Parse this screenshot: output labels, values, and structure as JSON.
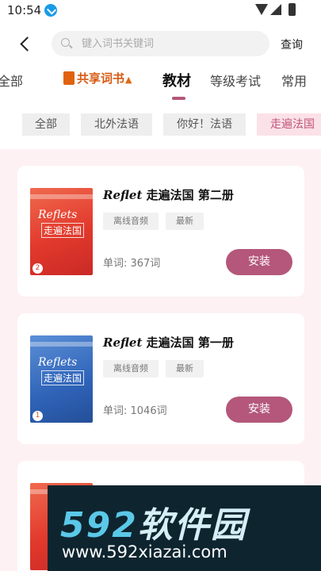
{
  "status_bar": {
    "time": "10:54",
    "icons": [
      "download-icon",
      "wifi-icon",
      "signal-icon",
      "battery-icon"
    ]
  },
  "header": {
    "back_icon": "chevron-left-icon",
    "search": {
      "placeholder": "键入词书关键词",
      "value": "",
      "icon": "search-icon"
    },
    "query_label": "查询"
  },
  "tabs": {
    "all": "全部",
    "shared": "共享词书",
    "textbook": "教材",
    "level_exam": "等级考试",
    "common": "常用",
    "active": "教材"
  },
  "filters": [
    "全部",
    "北外法语",
    "你好！法语",
    "走遍法国"
  ],
  "active_filter": "走遍法国",
  "books": [
    {
      "title_latin": "Reflet",
      "title_rest": "走遍法国 第二册",
      "tags": [
        "离线音频",
        "最新"
      ],
      "word_count": "单词: 367词",
      "action": "安装",
      "cover": {
        "script": "Reflets",
        "title": "走遍法国",
        "volume": "2",
        "color": "#e2392c"
      }
    },
    {
      "title_latin": "Reflet",
      "title_rest": "走遍法国 第一册",
      "tags": [
        "离线音频",
        "最新"
      ],
      "word_count": "单词: 1046词",
      "action": "安装",
      "cover": {
        "script": "Reflets",
        "title": "走遍法国",
        "volume": "1",
        "color": "#2f63b8"
      }
    }
  ],
  "watermark": {
    "logo_num": "592",
    "logo_text": "软件园",
    "url": "www.592xiazai.com"
  },
  "colors": {
    "accent": "#b4577a",
    "accent_light": "#fbe1e8",
    "list_background": "#fdf1f4",
    "shared_orange": "#d65a12"
  }
}
